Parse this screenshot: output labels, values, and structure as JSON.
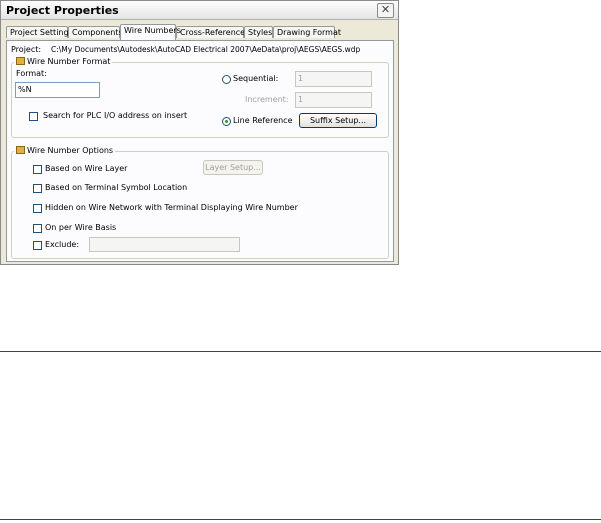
{
  "window": {
    "title": "Project Properties",
    "close_symbol": "✕",
    "close_icon": "close-icon"
  },
  "tabs": [
    {
      "label": "Project Settings",
      "active": false
    },
    {
      "label": "Components",
      "active": false
    },
    {
      "label": "Wire Numbers",
      "active": true
    },
    {
      "label": "Cross-References",
      "active": false
    },
    {
      "label": "Styles",
      "active": false
    },
    {
      "label": "Drawing Format",
      "active": false
    }
  ],
  "project": {
    "label": "Project:",
    "path": "C:\\My Documents\\Autodesk\\AutoCAD Electrical 2007\\AeData\\proj\\AEGS\\AEGS.wdp"
  },
  "wire_number_format": {
    "title": "Wire Number Format",
    "format_label": "Format:",
    "format_value": "%N",
    "search_plc_label": "Search for PLC I/O address on insert",
    "search_plc_checked": false,
    "sequential_label": "Sequential:",
    "sequential_value": "1",
    "sequential_selected": false,
    "increment_label": "Increment:",
    "increment_value": "1",
    "line_reference_label": "Line Reference",
    "line_reference_selected": true,
    "suffix_setup_label": "Suffix Setup..."
  },
  "wire_number_options": {
    "title": "Wire Number Options",
    "based_on_wire_layer_label": "Based on Wire Layer",
    "layer_setup_label": "Layer Setup...",
    "based_on_terminal_label": "Based on Terminal Symbol Location",
    "hidden_on_wire_network_label": "Hidden on Wire Network with Terminal Displaying Wire Number",
    "on_per_wire_basis_label": "On per Wire Basis",
    "exclude_label": "Exclude:",
    "exclude_value": ""
  }
}
